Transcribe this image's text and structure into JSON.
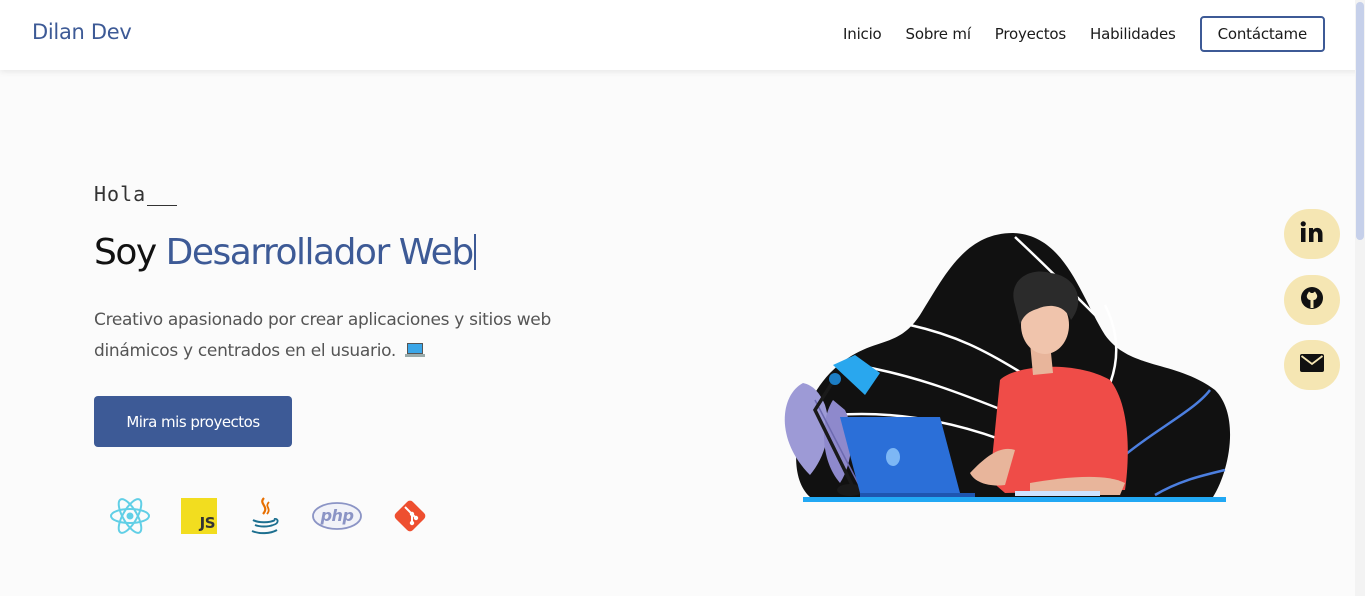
{
  "nav": {
    "brand": "Dilan Dev",
    "links": [
      "Inicio",
      "Sobre mí",
      "Proyectos",
      "Habilidades"
    ],
    "cta": "Contáctame"
  },
  "hero": {
    "greeting": "Hola",
    "headline_prefix": "Soy ",
    "headline_role": "Desarrollador Web",
    "description": "Creativo apasionado por crear aplicaciones y sitios web dinámicos y centrados en el usuario.",
    "button": "Mira mis proyectos"
  },
  "tech_icons": [
    "react-icon",
    "javascript-icon",
    "java-icon",
    "php-icon",
    "git-icon"
  ],
  "tech_labels": {
    "js": "JS",
    "php": "php"
  },
  "social": [
    "linkedin-icon",
    "github-icon",
    "email-icon"
  ],
  "colors": {
    "accent": "#3d5a96",
    "social_bg": "#f5e6b3",
    "shirt": "#ef4c48",
    "laptop": "#2b6fd8"
  }
}
